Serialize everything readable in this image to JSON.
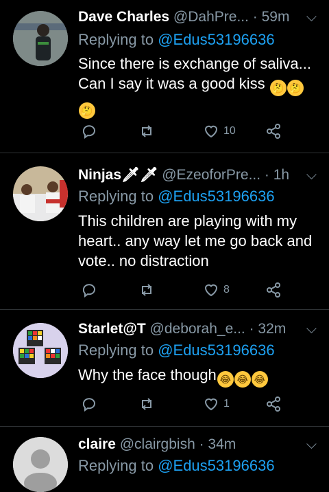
{
  "tweets": [
    {
      "name": "Dave Charles",
      "handle": "@DahPre...",
      "time": "· 59m",
      "replying_prefix": "Replying to ",
      "replying_to": "@Edus53196636",
      "text": "Since there is exchange of saliva... Can I say it was a good kiss",
      "emojis": [
        "🤔",
        "🤔",
        "🤔"
      ],
      "likes": "10"
    },
    {
      "name": "Ninjas",
      "name_suffix": "🗡🗡",
      "handle": "@EzeoforPre...",
      "time": "· 1h",
      "replying_prefix": "Replying to ",
      "replying_to": "@Edus53196636",
      "text": "This children are playing with my heart.. any way let me go back and vote.. no distraction",
      "likes": "8"
    },
    {
      "name": "Starlet@T",
      "handle": "@deborah_e...",
      "time": "· 32m",
      "replying_prefix": "Replying to ",
      "replying_to": "@Edus53196636",
      "text": "Why the face though",
      "emojis": [
        "😂",
        "😂",
        "😂"
      ],
      "likes": "1"
    },
    {
      "name": "claire",
      "handle": "@clairgbish",
      "time": "· 34m",
      "replying_prefix": "Replying to ",
      "replying_to": "@Edus53196636"
    }
  ],
  "icons": {
    "reply": "reply-icon",
    "retweet": "retweet-icon",
    "like": "heart-icon",
    "share": "share-icon",
    "more": "chevron-down-icon"
  },
  "colors": {
    "background": "#000000",
    "secondary_text": "#8899a6",
    "link": "#1da1f2",
    "divider": "#2f3336"
  }
}
